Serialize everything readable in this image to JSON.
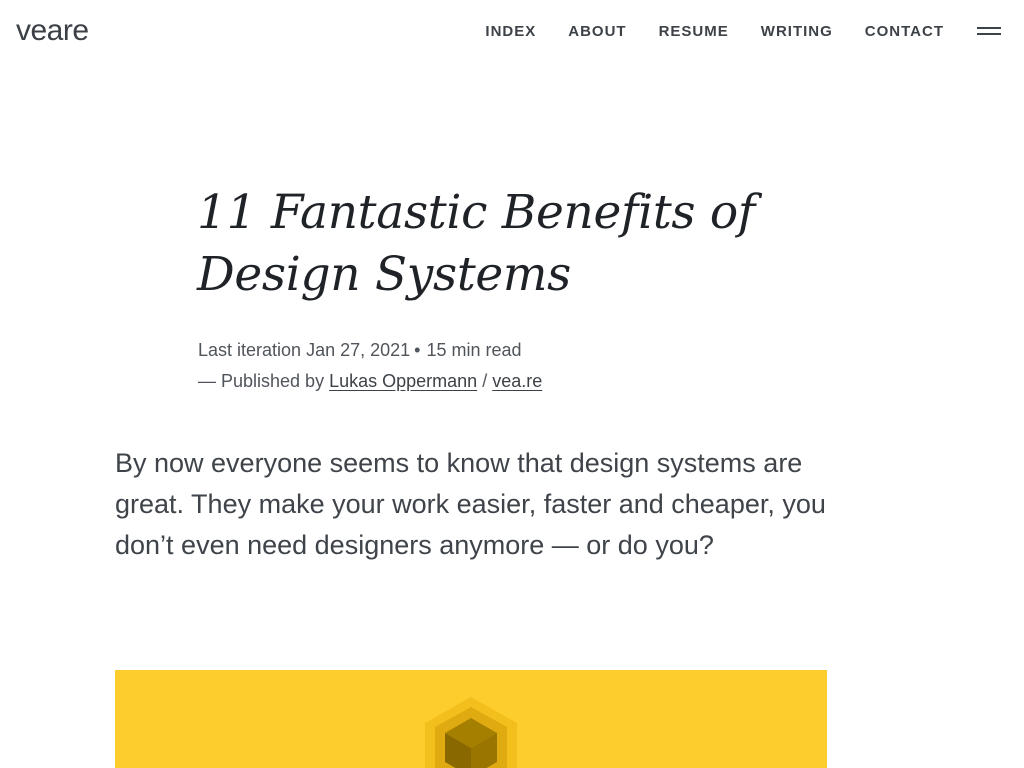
{
  "site": {
    "logo": "veare"
  },
  "nav": {
    "items": [
      {
        "label": "INDEX"
      },
      {
        "label": "ABOUT"
      },
      {
        "label": "RESUME"
      },
      {
        "label": "WRITING"
      },
      {
        "label": "CONTACT"
      }
    ],
    "menu_icon": "hamburger-menu-icon"
  },
  "article": {
    "title": "11 Fantastic Benefits of Design Systems",
    "last_iteration_label": "Last iteration",
    "date": "Jan 27, 2021",
    "separator": "•",
    "read_time": "15 min read",
    "published_by_label": "— Published by",
    "author": "Lukas Oppermann",
    "author_separator": "/",
    "site_link": "vea.re",
    "intro": "By now everyone seems to know that design systems are great. They make your work easier, faster and cheaper, you don’t even need designers anymore — or do you?"
  },
  "hero": {
    "background_color": "#fccd2c",
    "icon": "hexagon-cube-icon"
  }
}
